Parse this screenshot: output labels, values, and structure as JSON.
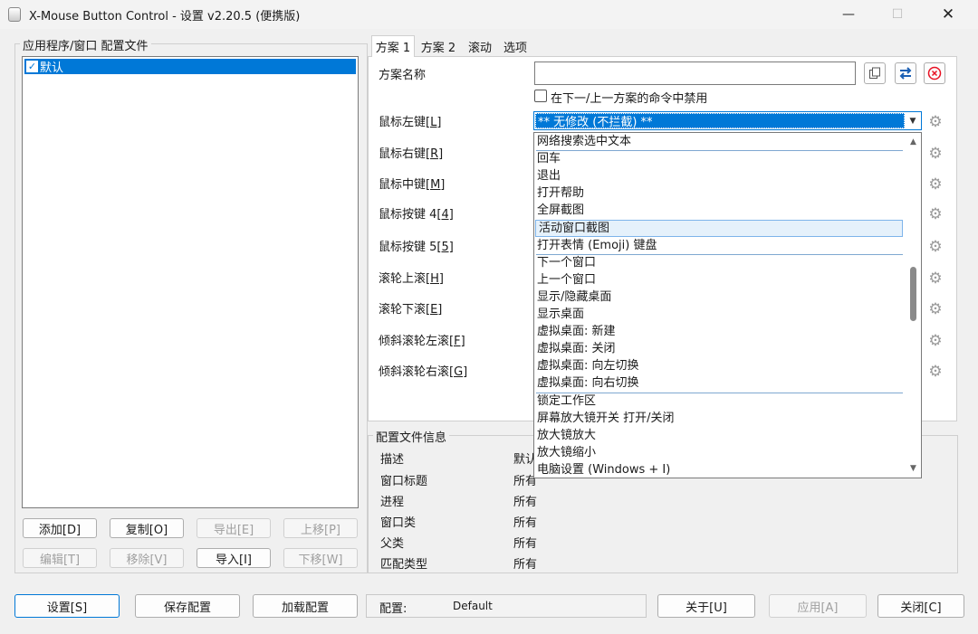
{
  "window": {
    "title": "X-Mouse Button Control - 设置 v2.20.5 (便携版)",
    "controls": {
      "minimize": "—",
      "maximize": "☐",
      "close": "✕"
    }
  },
  "profiles": {
    "group_label": "应用程序/窗口 配置文件",
    "items": [
      {
        "label": "默认",
        "checked": true
      }
    ],
    "buttons": {
      "add": "添加[D]",
      "copy": "复制[O]",
      "export": "导出[E]",
      "move_up": "上移[P]",
      "edit": "编辑[T]",
      "remove": "移除[V]",
      "import": "导入[I]",
      "move_down": "下移[W]"
    }
  },
  "tabs": [
    {
      "label": "方案 1",
      "active": true
    },
    {
      "label": "方案 2",
      "active": false
    },
    {
      "label": "滚动",
      "active": false
    },
    {
      "label": "选项",
      "active": false
    }
  ],
  "layer": {
    "name_label": "方案名称",
    "name_value": "",
    "disable_checkbox_label": "在下一/上一方案的命令中禁用",
    "disable_checked": false,
    "rows": [
      {
        "label": "鼠标左键",
        "key": "[L]"
      },
      {
        "label": "鼠标右键",
        "key": "[R]"
      },
      {
        "label": "鼠标中键",
        "key": "[M]"
      },
      {
        "label": "鼠标按键 4",
        "key": "[4]"
      },
      {
        "label": "鼠标按键 5",
        "key": "[5]"
      },
      {
        "label": "滚轮上滚",
        "key": "[H]"
      },
      {
        "label": "滚轮下滚",
        "key": "[E]"
      },
      {
        "label": "倾斜滚轮左滚",
        "key": "[F]"
      },
      {
        "label": "倾斜滚轮右滚",
        "key": "[G]"
      }
    ],
    "left_button_combo_value": "** 无修改 (不拦截) **",
    "icons": {
      "copy": "copy-icon",
      "swap": "swap-icon",
      "clear": "clear-icon",
      "settings": "gear-icon"
    }
  },
  "dropdown": {
    "items": [
      "网络搜索选中文本",
      "回车",
      "退出",
      "打开帮助",
      "全屏截图",
      "活动窗口截图",
      "打开表情 (Emoji) 键盘",
      "下一个窗口",
      "上一个窗口",
      "显示/隐藏桌面",
      "显示桌面",
      "虚拟桌面: 新建",
      "虚拟桌面: 关闭",
      "虚拟桌面: 向左切换",
      "虚拟桌面: 向右切换",
      "锁定工作区",
      "屏幕放大镜开关 打开/关闭",
      "放大镜放大",
      "放大镜缩小",
      "电脑设置 (Windows + I)"
    ],
    "highlighted_index": 5,
    "scroll_fraction": 0.4
  },
  "profile_info": {
    "group_label": "配置文件信息",
    "rows": [
      {
        "label": "描述",
        "value": "默认"
      },
      {
        "label": "窗口标题",
        "value": "所有"
      },
      {
        "label": "进程",
        "value": "所有"
      },
      {
        "label": "窗口类",
        "value": "所有"
      },
      {
        "label": "父类",
        "value": "所有"
      },
      {
        "label": "匹配类型",
        "value": "所有"
      }
    ]
  },
  "footer": {
    "settings": "设置[S]",
    "save_config": "保存配置",
    "load_config": "加载配置",
    "config_label": "配置:",
    "config_value": "Default",
    "about": "关于[U]",
    "apply": "应用[A]",
    "close": "关闭[C]"
  },
  "colors": {
    "accent": "#0078d7",
    "clear_red": "#e81123",
    "swap_blue": "#1a5fb4"
  }
}
